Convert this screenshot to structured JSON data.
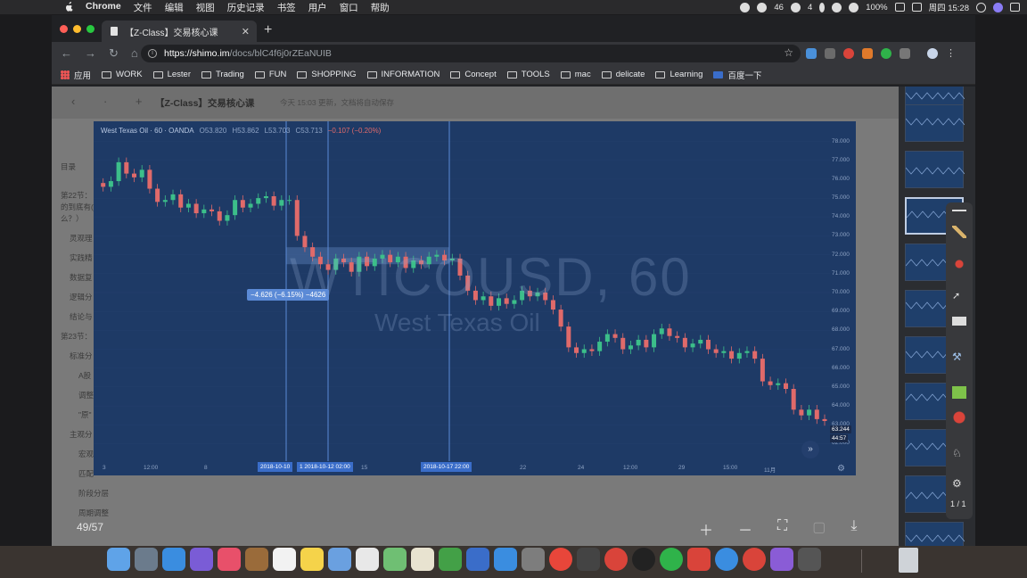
{
  "menubar": {
    "app": "Chrome",
    "menus": [
      "文件",
      "编辑",
      "视图",
      "历史记录",
      "书签",
      "用户",
      "窗口",
      "帮助"
    ],
    "status": {
      "notif1": "46",
      "notif2": "4",
      "battery": "100%",
      "clock": "周四 15:28"
    }
  },
  "browser": {
    "tab_title": "【Z-Class】交易核心课",
    "url_host": "https://shimo.im",
    "url_path": "/docs/blC4f6j0rZEaNUIB",
    "bookmarks": [
      "应用",
      "WORK",
      "Lester",
      "Trading",
      "FUN",
      "SHOPPING",
      "INFORMATION",
      "Concept",
      "TOOLS",
      "mac",
      "delicate",
      "Learning",
      "百度一下"
    ]
  },
  "doc": {
    "title": "【Z-Class】交易核心课",
    "saved_status": "今天 15:03 更新，文档将自动保存",
    "outline": [
      "目录",
      "第22节：",
      "的到底有(",
      "么？）",
      "灵观理",
      "实践精",
      "数据复",
      "逻辑分",
      "结论与",
      "第23节：",
      "标准分",
      "A股",
      "调整",
      "\"原\"",
      "主观分",
      "宏观",
      "匹配",
      "阶段分层",
      "周期调整"
    ]
  },
  "viewer": {
    "counter": "49/57",
    "pager": "1 / 1"
  },
  "chart_data": {
    "type": "candlestick",
    "symbol": "West Texas Oil · 60 · OANDA",
    "ohlc_label": {
      "o": "O53.820",
      "h": "H53.862",
      "l": "L53.703",
      "c": "C53.713",
      "chg": "−0.107 (−0.20%)"
    },
    "watermark": "WTICOUSD, 60",
    "watermark_sub": "West Texas Oil",
    "measure_label": "−4.626 (−6.15%) −4626",
    "y_ticks": [
      "78.000",
      "77.000",
      "76.000",
      "75.000",
      "74.000",
      "73.000",
      "72.000",
      "71.000",
      "70.000",
      "69.000",
      "68.000",
      "67.000",
      "66.000",
      "65.000",
      "64.000",
      "63.000",
      "62.000"
    ],
    "ylim": [
      61.5,
      78.5
    ],
    "last_price": "63.244",
    "countdown": "44:57",
    "x_ticks": [
      "3",
      "12:00",
      "8",
      "15",
      "22",
      "24",
      "12:00",
      "29",
      "15:00",
      "11月"
    ],
    "x_tags": [
      "2018-10-10",
      "1 2018-10-12 02:00",
      "2018-10-17  22:00"
    ],
    "close_path": [
      75.8,
      75.6,
      75.9,
      76.9,
      76.3,
      76.1,
      76.5,
      75.5,
      74.8,
      74.9,
      75.2,
      74.5,
      74.7,
      74.2,
      74.4,
      74.3,
      73.8,
      74.1,
      74.9,
      74.5,
      74.7,
      75.0,
      75.1,
      74.6,
      74.9,
      74.9,
      73.0,
      72.4,
      71.9,
      71.5,
      71.2,
      71.8,
      71.6,
      71.1,
      71.9,
      71.4,
      71.8,
      72.0,
      71.6,
      71.9,
      71.3,
      71.7,
      71.5,
      71.9,
      72.0,
      71.7,
      71.8,
      70.9,
      70.1,
      69.6,
      69.8,
      69.3,
      69.7,
      69.4,
      69.6,
      70.1,
      69.8,
      70.0,
      69.6,
      69.1,
      68.2,
      67.1,
      66.8,
      67.0,
      66.9,
      67.4,
      67.8,
      67.6,
      67.0,
      67.2,
      67.5,
      67.1,
      67.8,
      68.1,
      67.7,
      67.6,
      67.1,
      67.3,
      67.5,
      67.0,
      66.8,
      66.9,
      66.5,
      66.8,
      66.9,
      66.5,
      65.3,
      65.1,
      65.2,
      64.9,
      63.8,
      63.5,
      63.8,
      63.3,
      63.2
    ]
  },
  "colors": {
    "chart_bg": "#1e3a66",
    "up": "#3cbf8a",
    "down": "#e06a6a",
    "accent": "#3a6dc9"
  }
}
